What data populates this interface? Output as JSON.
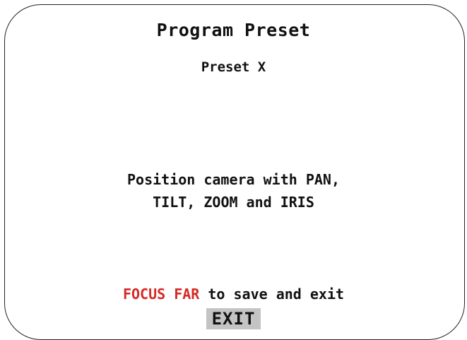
{
  "menu": {
    "title": "Program Preset",
    "subtitle": "Preset X",
    "instruction_line1": "Position camera with PAN,",
    "instruction_line2": "TILT, ZOOM and IRIS",
    "save_key": "FOCUS FAR",
    "save_text": " to save and exit",
    "exit_label": "EXIT",
    "colors": {
      "highlight": "#d42a26",
      "exit_background": "#c4c4c4",
      "text": "#111111"
    }
  }
}
